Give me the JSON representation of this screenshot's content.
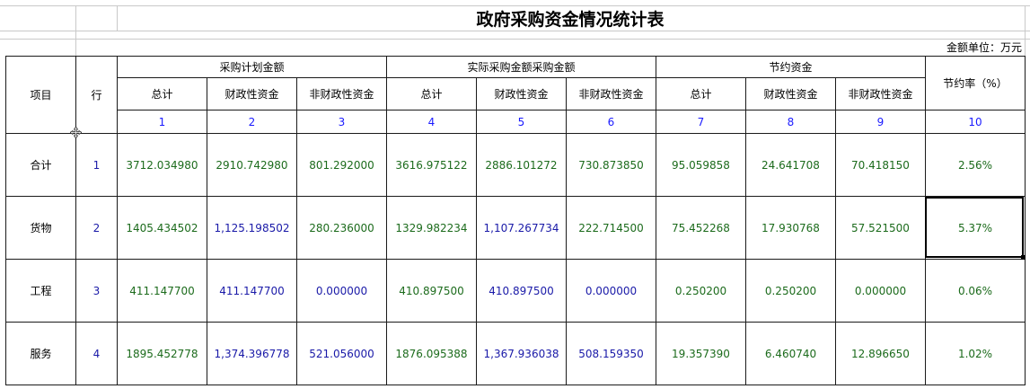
{
  "title": "政府采购资金情况统计表",
  "unit_label": "金额单位：万元",
  "headers": {
    "item": "项目",
    "row": "行",
    "groups": [
      "采购计划金额",
      "实际采购金额采购金额",
      "节约资金"
    ],
    "savings_rate": "节约率（%）",
    "sub": [
      "总计",
      "财政性资金",
      "非财政性资金",
      "总计",
      "财政性资金",
      "非财政性资金",
      "总计",
      "财政性资金",
      "非财政性资金"
    ],
    "indices": [
      "1",
      "2",
      "3",
      "4",
      "5",
      "6",
      "7",
      "8",
      "9",
      "10"
    ]
  },
  "rows": [
    {
      "item": "合计",
      "row": "1",
      "values": [
        "3712.034980",
        "2910.742980",
        "801.292000",
        "3616.975122",
        "2886.101272",
        "730.873850",
        "95.059858",
        "24.641708",
        "70.418150"
      ],
      "rate": "2.56%"
    },
    {
      "item": "货物",
      "row": "2",
      "values": [
        "1405.434502",
        "1,125.198502",
        "280.236000",
        "1329.982234",
        "1,107.267734",
        "222.714500",
        "75.452268",
        "17.930768",
        "57.521500"
      ],
      "rate": "5.37%"
    },
    {
      "item": "工程",
      "row": "3",
      "values": [
        "411.147700",
        "411.147700",
        "0.000000",
        "410.897500",
        "410.897500",
        "0.000000",
        "0.250200",
        "0.250200",
        "0.000000"
      ],
      "rate": "0.06%"
    },
    {
      "item": "服务",
      "row": "4",
      "values": [
        "1895.452778",
        "1,374.396778",
        "521.056000",
        "1876.095388",
        "1,367.936038",
        "508.159350",
        "19.357390",
        "6.460740",
        "12.896650"
      ],
      "rate": "1.02%"
    }
  ],
  "value_colors": [
    [
      "green",
      "green",
      "green",
      "green",
      "green",
      "green",
      "green",
      "green",
      "green"
    ],
    [
      "green",
      "blue",
      "green",
      "green",
      "blue",
      "green",
      "green",
      "green",
      "green"
    ],
    [
      "green",
      "blue",
      "blue",
      "green",
      "blue",
      "blue",
      "green",
      "green",
      "green"
    ],
    [
      "green",
      "blue",
      "blue",
      "green",
      "blue",
      "blue",
      "green",
      "green",
      "green"
    ]
  ],
  "colors": {
    "green": "#1c6b1c",
    "blue": "#1a1aa8",
    "index": "#1a1aff"
  }
}
